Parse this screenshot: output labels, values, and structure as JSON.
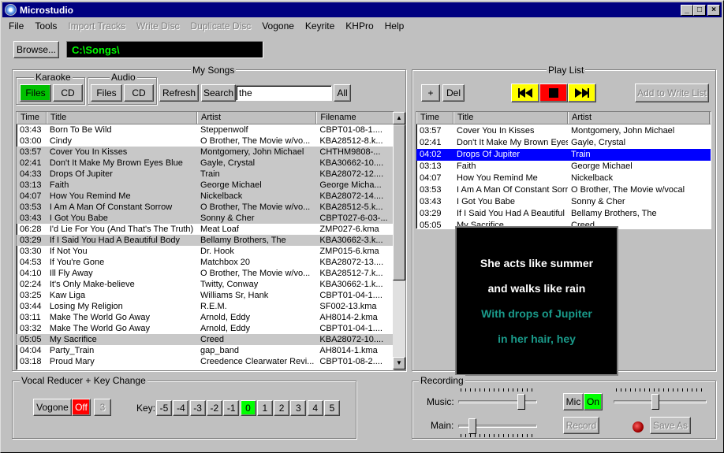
{
  "window": {
    "title": "Microstudio"
  },
  "menu": [
    {
      "label": "File",
      "enabled": true
    },
    {
      "label": "Tools",
      "enabled": true
    },
    {
      "label": "Import Tracks",
      "enabled": false
    },
    {
      "label": "Write Disc",
      "enabled": false
    },
    {
      "label": "Duplicate Disc",
      "enabled": false
    },
    {
      "label": "Vogone",
      "enabled": true
    },
    {
      "label": "Keyrite",
      "enabled": true
    },
    {
      "label": "KHPro",
      "enabled": true
    },
    {
      "label": "Help",
      "enabled": true
    }
  ],
  "browse": {
    "label": "Browse...",
    "path": "C:\\Songs\\"
  },
  "my_songs": {
    "title": "My Songs",
    "karaoke": {
      "label": "Karaoke",
      "files": "Files",
      "cd": "CD"
    },
    "audio": {
      "label": "Audio",
      "files": "Files",
      "cd": "CD"
    },
    "refresh": "Refresh",
    "search": "Search",
    "search_value": "the",
    "all": "All",
    "columns": [
      "Time",
      "Title",
      "Artist",
      "Filename"
    ],
    "rows": [
      [
        "03:43",
        "Born To Be Wild",
        "Steppenwolf",
        "CBPT01-08-1...."
      ],
      [
        "03:00",
        "Cindy",
        "O Brother, The Movie w/vo...",
        "KBA28512-8.k..."
      ],
      [
        "03:57",
        "Cover You In Kisses",
        "Montgomery, John Michael",
        "CHTHM9808-..."
      ],
      [
        "02:41",
        "Don't It Make My Brown Eyes Blue",
        "Gayle, Crystal",
        "KBA30662-10...."
      ],
      [
        "04:33",
        "Drops Of Jupiter",
        "Train",
        "KBA28072-12...."
      ],
      [
        "03:13",
        "Faith",
        "George Michael",
        "George Micha..."
      ],
      [
        "04:07",
        "How You Remind Me",
        "Nickelback",
        "KBA28072-14...."
      ],
      [
        "03:53",
        "I Am A Man Of Constant Sorrow",
        "O Brother, The Movie w/vo...",
        "KBA28512-5.k..."
      ],
      [
        "03:43",
        "I Got You Babe",
        "Sonny & Cher",
        "CBPT027-6-03-..."
      ],
      [
        "06:28",
        "I'd Lie For You (And That's The Truth)",
        "Meat Loaf",
        "ZMP027-6.kma"
      ],
      [
        "03:29",
        "If I Said You Had A Beautiful Body",
        "Bellamy Brothers, The",
        "KBA30662-3.k..."
      ],
      [
        "03:30",
        "If Not You",
        "Dr. Hook",
        "ZMP015-6.kma"
      ],
      [
        "04:53",
        "If You're Gone",
        "Matchbox 20",
        "KBA28072-13...."
      ],
      [
        "04:10",
        "Ill Fly Away",
        "O Brother, The Movie w/vo...",
        "KBA28512-7.k..."
      ],
      [
        "02:24",
        "It's Only Make-believe",
        "Twitty, Conway",
        "KBA30662-1.k..."
      ],
      [
        "03:25",
        "Kaw Liga",
        "Williams Sr, Hank",
        "CBPT01-04-1...."
      ],
      [
        "03:44",
        "Losing My Religion",
        "R.E.M.",
        "SF002-13.kma"
      ],
      [
        "03:11",
        "Make The World Go Away",
        "Arnold, Eddy",
        "AH8014-2.kma"
      ],
      [
        "03:32",
        "Make The World Go Away",
        "Arnold, Eddy",
        "CBPT01-04-1...."
      ],
      [
        "05:05",
        "My Sacrifice",
        "Creed",
        "KBA28072-10...."
      ],
      [
        "04:04",
        "Party_Train",
        "gap_band",
        "AH8014-1.kma"
      ],
      [
        "03:18",
        "Proud Mary",
        "Creedence Clearwater Revi...",
        "CBPT01-08-2...."
      ]
    ],
    "highlighted_rows": [
      2,
      3,
      4,
      5,
      6,
      7,
      8,
      10,
      19
    ]
  },
  "playlist": {
    "title": "Play List",
    "add": "+",
    "del": "Del",
    "add_to_write": "Add to Write List",
    "columns": [
      "Time",
      "Title",
      "Artist"
    ],
    "rows": [
      [
        "03:57",
        "Cover You In Kisses",
        "Montgomery, John Michael"
      ],
      [
        "02:41",
        "Don't It Make My Brown Eyes",
        "Gayle, Crystal"
      ],
      [
        "04:02",
        "Drops Of Jupiter",
        "Train"
      ],
      [
        "03:13",
        "Faith",
        "George Michael"
      ],
      [
        "04:07",
        "How You Remind Me",
        "Nickelback"
      ],
      [
        "03:53",
        "I Am A Man Of Constant Sorro",
        "O Brother, The Movie w/vocal"
      ],
      [
        "03:43",
        "I Got You Babe",
        "Sonny & Cher"
      ],
      [
        "03:29",
        "If I Said You Had A Beautiful",
        "Bellamy Brothers, The"
      ],
      [
        "05:05",
        "My Sacrifice",
        "Creed"
      ]
    ],
    "selected_row": 2
  },
  "lyrics": {
    "lines": [
      "She acts like summer",
      "and walks like rain",
      "With drops of Jupiter",
      "in her hair, hey"
    ],
    "sung_color": "#ffffff",
    "unsung_color": "#1a9a8a"
  },
  "vocal_reducer": {
    "title": "Vocal Reducer + Key Change",
    "vogone": "Vogone",
    "off": "Off",
    "three": "3",
    "key_label": "Key:",
    "keys": [
      "-5",
      "-4",
      "-3",
      "-2",
      "-1",
      "0",
      "1",
      "2",
      "3",
      "4",
      "5"
    ],
    "active_key": "0"
  },
  "recording": {
    "title": "Recording",
    "music_label": "Music:",
    "main_label": "Main:",
    "mic": "Mic",
    "on": "On",
    "record": "Record",
    "save_as": "Save As",
    "music_level": 0.85,
    "main_level": 0.15,
    "mic_level": 0.45
  },
  "colors": {
    "title_bar": "#000080",
    "selection": "#0000ff",
    "active_green": "#00ff00",
    "off_red": "#ff0000",
    "transport_yellow": "#ffff00"
  }
}
